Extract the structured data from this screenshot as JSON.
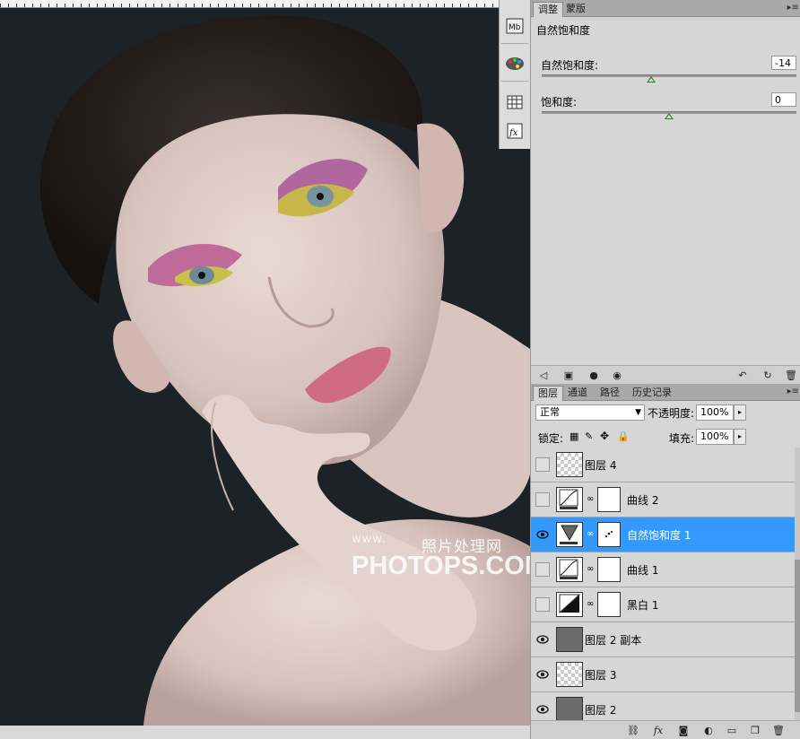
{
  "adjustments_panel": {
    "tabs": [
      {
        "label": "调整",
        "active": true
      },
      {
        "label": "蒙版",
        "active": false
      }
    ],
    "title": "自然饱和度",
    "vibrance": {
      "label": "自然饱和度:",
      "value": "-14",
      "slider_fraction": 0.43
    },
    "saturation": {
      "label": "饱和度:",
      "value": "0",
      "slider_fraction": 0.5
    },
    "toolbar_icons": [
      "back-arrow-icon",
      "clip-to-layer-icon",
      "eye-mask-icon",
      "visibility-icon",
      "reset-icon",
      "refresh-icon",
      "trash-icon"
    ]
  },
  "icon_strip": [
    "mini-bridge-icon",
    "color-palette-icon",
    "swatches-grid-icon",
    "fx-styles-icon"
  ],
  "layers_panel": {
    "tabs": [
      {
        "label": "图层",
        "active": true
      },
      {
        "label": "通道",
        "active": false
      },
      {
        "label": "路径",
        "active": false
      },
      {
        "label": "历史记录",
        "active": false
      }
    ],
    "blend_mode": "正常",
    "opacity_label": "不透明度:",
    "opacity_value": "100%",
    "lock_label": "锁定:",
    "fill_label": "填充:",
    "fill_value": "100%",
    "layers": [
      {
        "name": "图层 4",
        "visible": false,
        "thumb": "checker",
        "mask": false,
        "selected": false
      },
      {
        "name": "曲线 2",
        "visible": false,
        "thumb": "curves",
        "mask": true,
        "selected": false
      },
      {
        "name": "自然饱和度 1",
        "visible": true,
        "thumb": "vibrance",
        "mask": true,
        "selected": true
      },
      {
        "name": "曲线 1",
        "visible": false,
        "thumb": "curves",
        "mask": true,
        "selected": false
      },
      {
        "name": "黑白 1",
        "visible": false,
        "thumb": "blackwhite",
        "mask": true,
        "selected": false
      },
      {
        "name": "图层 2 副本",
        "visible": true,
        "thumb": "gray",
        "mask": false,
        "selected": false
      },
      {
        "name": "图层 3",
        "visible": true,
        "thumb": "checker",
        "mask": false,
        "selected": false
      },
      {
        "name": "图层 2",
        "visible": true,
        "thumb": "gray",
        "mask": false,
        "selected": false
      }
    ],
    "bottom_icons": [
      "link-icon",
      "fx-icon",
      "add-mask-icon",
      "adjustment-icon",
      "group-folder-icon",
      "new-layer-icon",
      "delete-icon"
    ]
  },
  "watermark": {
    "url": "www.",
    "chinese": "照片处理网",
    "brand": "PHOTOPS.COM"
  },
  "colors": {
    "selection": "#3399ff",
    "panel_bg": "#d6d6d6",
    "canvas_bg": "#1c2226"
  }
}
